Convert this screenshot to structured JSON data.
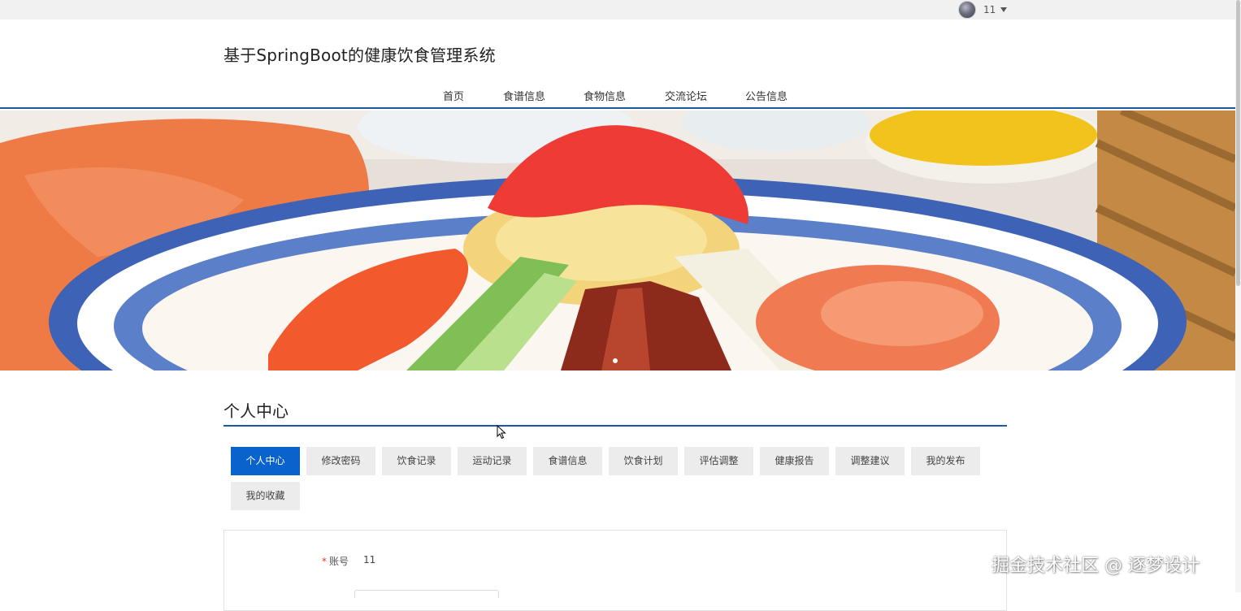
{
  "user": {
    "name": "11"
  },
  "site": {
    "title": "基于SpringBoot的健康饮食管理系统"
  },
  "nav": {
    "items": [
      {
        "label": "首页"
      },
      {
        "label": "食谱信息"
      },
      {
        "label": "食物信息"
      },
      {
        "label": "交流论坛"
      },
      {
        "label": "公告信息"
      }
    ]
  },
  "banner": {
    "prev_label": "‹",
    "next_label": "›",
    "slide_count": 1,
    "active_slide": 1
  },
  "section": {
    "title": "个人中心"
  },
  "tabs": [
    {
      "label": "个人中心",
      "active": true
    },
    {
      "label": "修改密码"
    },
    {
      "label": "饮食记录"
    },
    {
      "label": "运动记录"
    },
    {
      "label": "食谱信息"
    },
    {
      "label": "饮食计划"
    },
    {
      "label": "评估调整"
    },
    {
      "label": "健康报告"
    },
    {
      "label": "调整建议"
    },
    {
      "label": "我的发布"
    },
    {
      "label": "我的收藏"
    }
  ],
  "form": {
    "account": {
      "required_mark": "*",
      "label": "账号",
      "value": "11"
    }
  },
  "watermark": {
    "text": "掘金技术社区 @ 逐梦设计"
  },
  "colors": {
    "accent": "#0a62cc",
    "nav_line": "#1a5aa5",
    "required": "#e0382b",
    "tab_bg": "#ececec"
  }
}
